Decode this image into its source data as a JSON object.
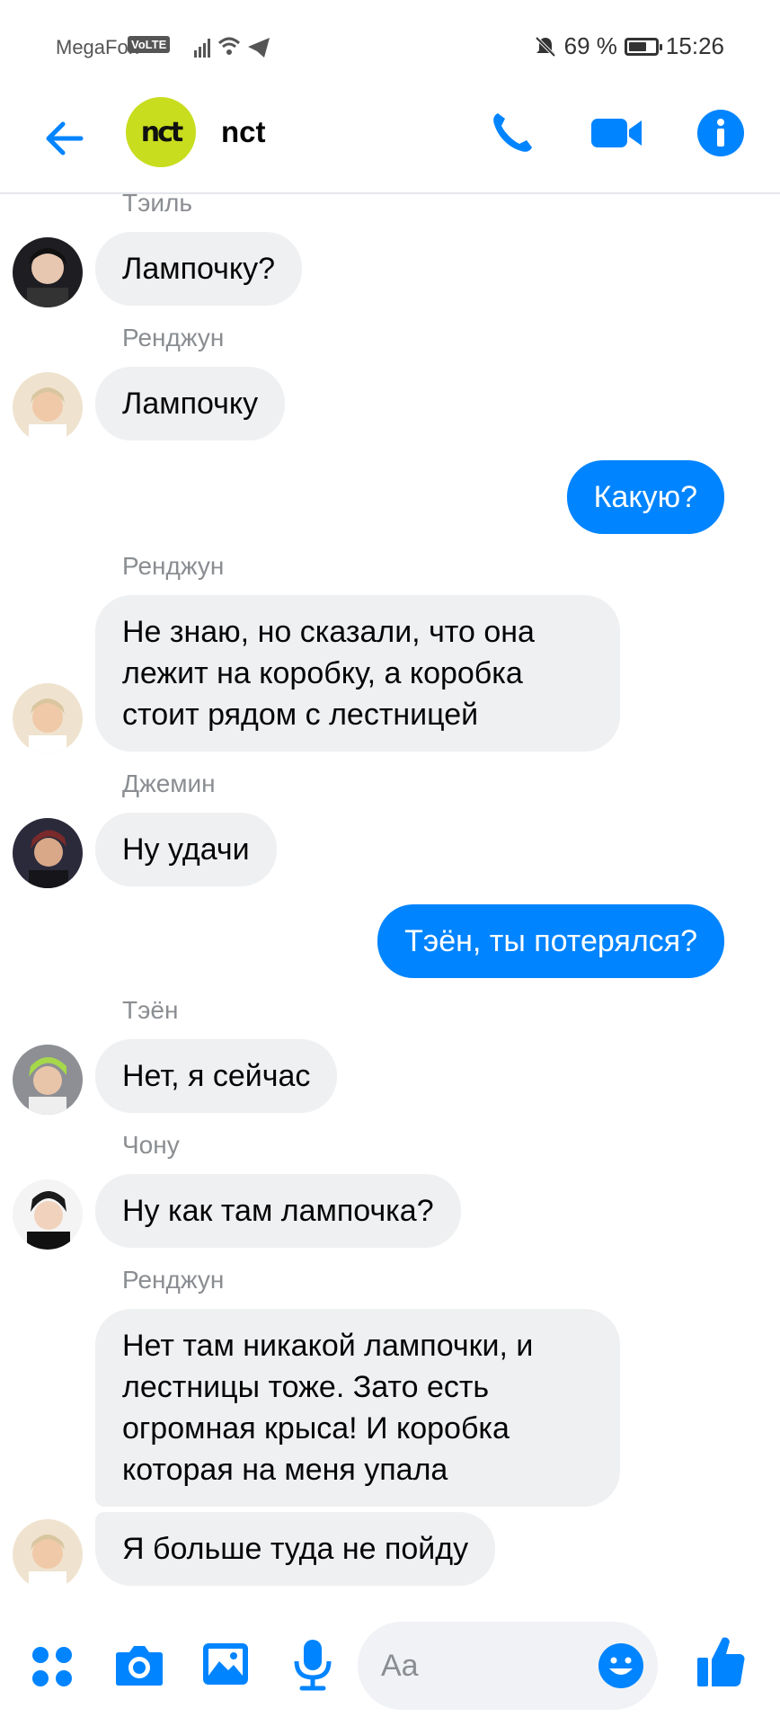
{
  "status_bar": {
    "carrier": "MegaFon",
    "volte": "VoLTE",
    "battery": "69 %",
    "battery_level": 0.69,
    "time": "15:26"
  },
  "header": {
    "avatar_text": "nct",
    "title": "nct"
  },
  "messages": [
    {
      "sender": "Тэиль",
      "text": "Лампочку?"
    },
    {
      "sender": "Ренджун",
      "text": "Лампочку"
    },
    {
      "sender": "",
      "text": "Какую?"
    },
    {
      "sender": "Ренджун",
      "text": "Не знаю, но сказали, что она лежит на коробку, а коробка стоит рядом с лестницей"
    },
    {
      "sender": "Джемин",
      "text": "Ну удачи"
    },
    {
      "sender": "",
      "text": "Тэён, ты потерялся?"
    },
    {
      "sender": "Тэён",
      "text": "Нет, я сейчас"
    },
    {
      "sender": "Чону",
      "text": "Ну как там лампочка?"
    },
    {
      "sender": "Ренджун",
      "text": "Нет там никакой лампочки, и лестницы тоже. Зато есть огромная крыса! И коробка которая на меня упала"
    },
    {
      "sender": "",
      "text": "Я больше туда не пойду"
    }
  ],
  "composer": {
    "placeholder": "Aa"
  },
  "colors": {
    "accent": "#0084ff",
    "incoming_bubble": "#eff0f2",
    "nct_logo": "#c8dd1e"
  },
  "icons": [
    "back-arrow-icon",
    "phone-icon",
    "video-camera-icon",
    "info-icon",
    "apps-icon",
    "camera-icon",
    "gallery-icon",
    "microphone-icon",
    "emoji-icon",
    "thumbs-up-icon"
  ]
}
